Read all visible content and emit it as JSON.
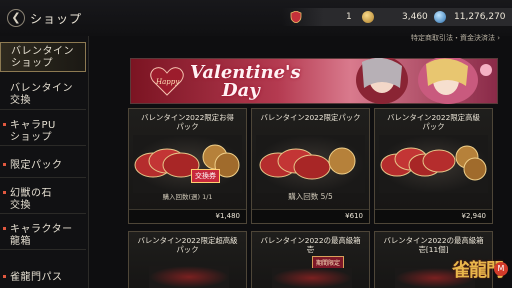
{
  "header": {
    "back_glyph": "❮",
    "title": "ショップ"
  },
  "currencies": [
    {
      "icon": "rank-badge-icon",
      "value": "1"
    },
    {
      "icon": "gold-coin-icon",
      "value": "3,460"
    },
    {
      "icon": "blue-orb-icon",
      "value": "11,276,270"
    }
  ],
  "legal_link": "特定商取引法・資金決済法",
  "sidebar": {
    "items": [
      {
        "label": "バレンタインショップ",
        "lines": [
          "バレンタイン",
          "ショップ"
        ]
      },
      {
        "label": "バレンタイン交換",
        "lines": [
          "バレンタイン",
          "交換"
        ]
      },
      {
        "label": "キャラPUショップ",
        "lines": [
          "キャラPU",
          "ショップ"
        ]
      },
      {
        "label": "限定パック",
        "lines": [
          "限定パック"
        ]
      },
      {
        "label": "幻獣の石交換",
        "lines": [
          "幻獣の石",
          "交換"
        ]
      },
      {
        "label": "キャラクター龍箱",
        "lines": [
          "キャラクター",
          "龍箱"
        ]
      },
      {
        "label": "雀龍門パス",
        "lines": [
          "雀龍門パス"
        ]
      }
    ]
  },
  "banner": {
    "small_text": "Happy",
    "line1": "Valentine's",
    "line2": "Day"
  },
  "cards": [
    {
      "title1": "バレンタイン2022限定お得",
      "title2": "パック",
      "limit": "購入回数(週) 1/1",
      "price": "¥1,480",
      "badge": "交換券"
    },
    {
      "title1": "バレンタイン2022限定パック",
      "title2": "",
      "limit": "購入回数 5/5",
      "price": "¥610",
      "badge": ""
    },
    {
      "title1": "バレンタイン2022限定高級",
      "title2": "パック",
      "limit": "",
      "price": "¥2,940",
      "badge": ""
    },
    {
      "title1": "バレンタイン2022限定超高級",
      "title2": "パック",
      "limit": "",
      "price": "",
      "badge": ""
    },
    {
      "title1": "バレンタイン2022の最高級箱",
      "title2": "壱",
      "limit": "",
      "price": "",
      "badge": "期間限定"
    },
    {
      "title1": "バレンタイン2022の最高級箱",
      "title2": "壱[11個]",
      "limit": "",
      "price": "",
      "badge": ""
    }
  ],
  "logo_text": "雀龍門",
  "colors": {
    "accent": "#8d7a52",
    "banner_red": "#b43a50",
    "badge_red": "#c8283c"
  }
}
